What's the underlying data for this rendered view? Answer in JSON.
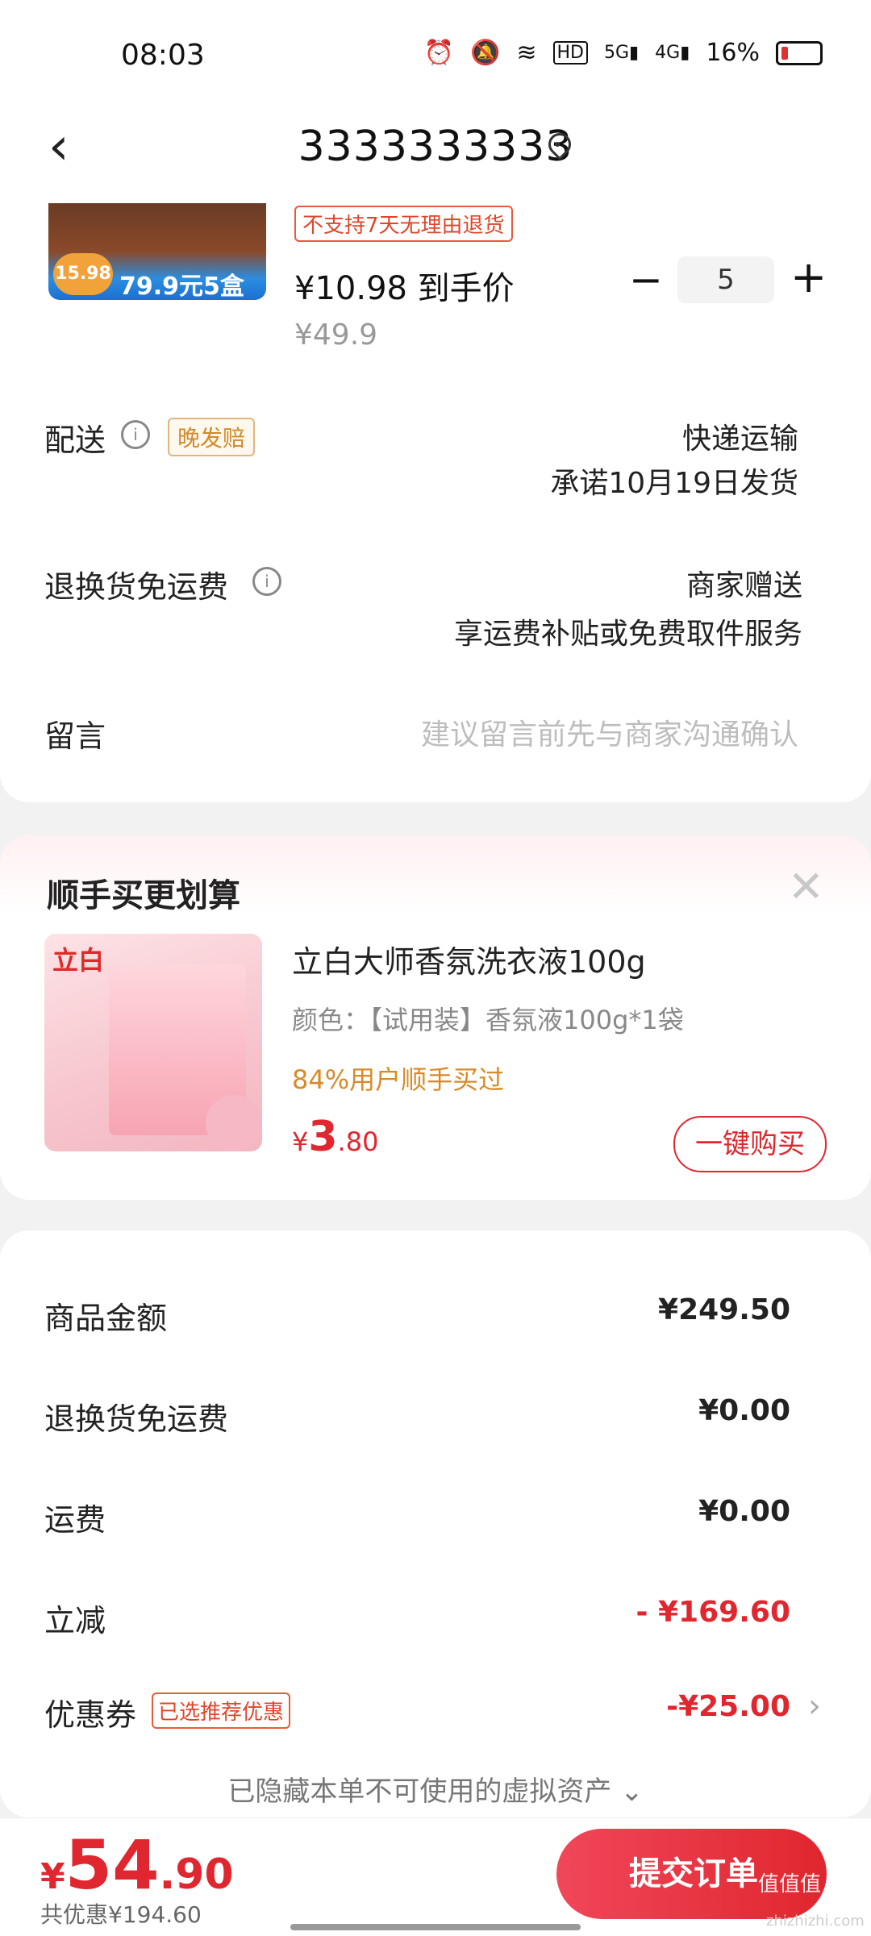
{
  "status_bar": {
    "time": "08:03",
    "icons": [
      "alarm-icon",
      "mute-icon",
      "wifi-icon",
      "hd-icon",
      "5g-signal-icon",
      "4g-signal-icon"
    ],
    "battery": "16%"
  },
  "header": {
    "title": "3333333333"
  },
  "product": {
    "image_price": "15.98",
    "image_promo": "79.9元5盒",
    "no_return_tag": "不支持7天无理由退货",
    "price": "¥10.98 到手价",
    "original_price": "¥49.9",
    "quantity": "5",
    "minus": "−",
    "plus": "+"
  },
  "delivery": {
    "label": "配送",
    "late_tag": "晚发赔",
    "method": "快递运输",
    "promise": "承诺10月19日发货"
  },
  "return_shipping": {
    "label": "退换货免运费",
    "value1": "商家赠送",
    "value2": "享运费补贴或免费取件服务"
  },
  "message": {
    "label": "留言",
    "placeholder": "建议留言前先与商家沟通确认"
  },
  "upsell": {
    "title": "顺手买更划算",
    "close": "✕",
    "image_brand": "立白",
    "name": "立白大师香氛洗衣液100g",
    "spec": "颜色：【试用装】香氛液100g*1袋",
    "bought": "84%用户顺手买过",
    "price_yen": "¥",
    "price_int": "3",
    "price_dec": ".80",
    "buy_button": "一键购买"
  },
  "summary": {
    "goods_label": "商品金额",
    "goods_value": "¥249.50",
    "return_label": "退换货免运费",
    "return_value": "¥0.00",
    "shipping_label": "运费",
    "shipping_value": "¥0.00",
    "discount_label": "立减",
    "discount_value": "- ¥169.60",
    "coupon_label": "优惠券",
    "coupon_tag": "已选推荐优惠",
    "coupon_value": "-¥25.00",
    "hidden_note": "已隐藏本单不可使用的虚拟资产 ⌄"
  },
  "footer": {
    "total_yen": "¥",
    "total_int": "54",
    "total_dec": ".90",
    "saving": "共优惠¥194.60",
    "submit": "提交订单",
    "watermark": "值值值",
    "watermark_url": "zhizhizhi.com"
  }
}
